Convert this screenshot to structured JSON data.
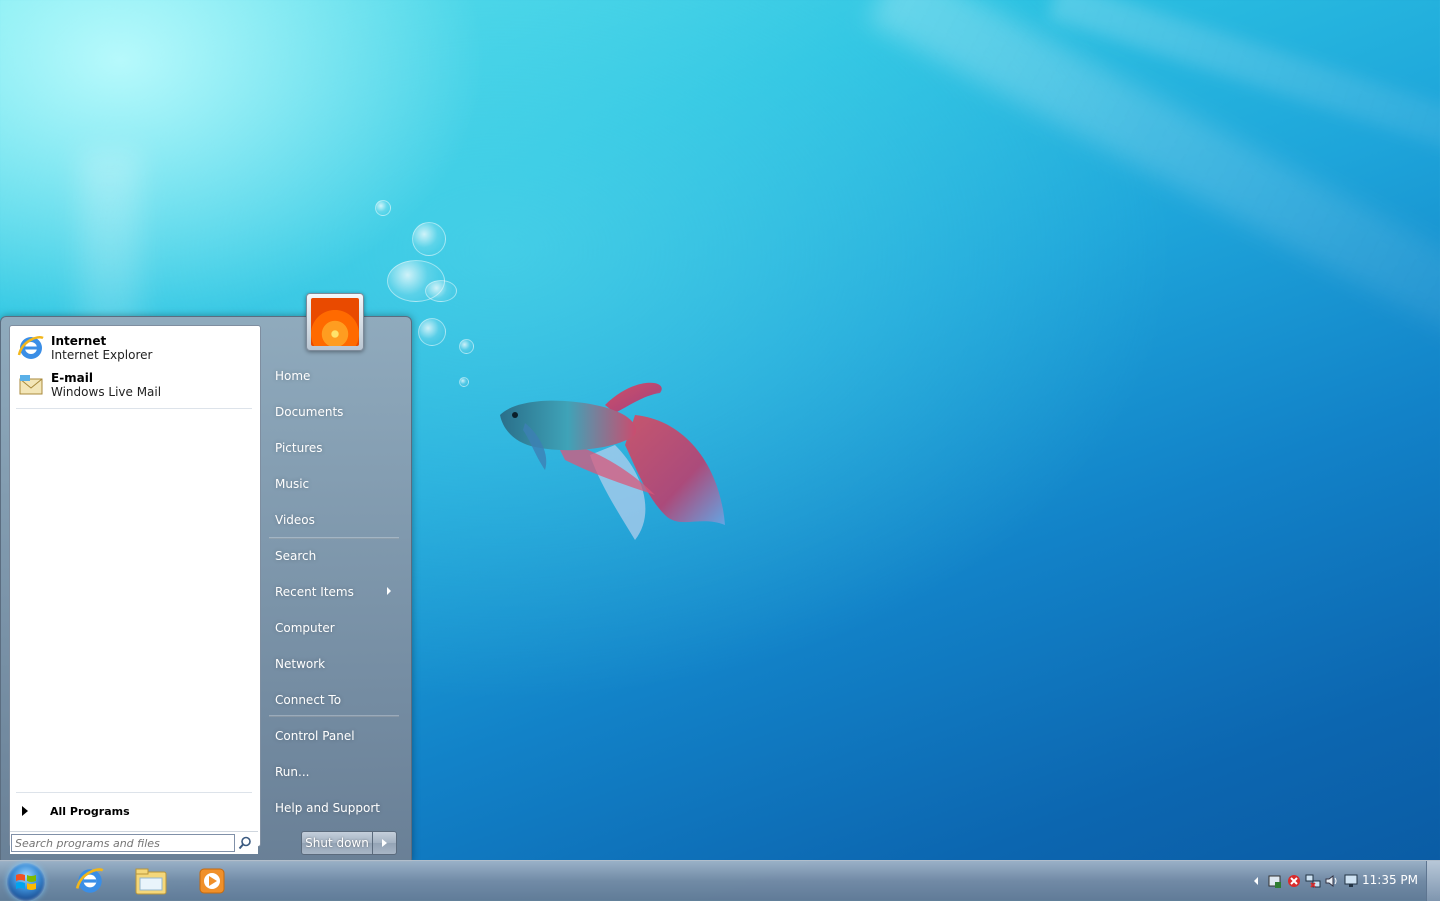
{
  "pinned": [
    {
      "title": "Internet",
      "subtitle": "Internet Explorer",
      "icon": "internet-explorer-icon"
    },
    {
      "title": "E-mail",
      "subtitle": "Windows Live Mail",
      "icon": "windows-live-mail-icon"
    }
  ],
  "all_programs": "All Programs",
  "search": {
    "placeholder": "Search programs and files"
  },
  "right_items": [
    "Home",
    "Documents",
    "Pictures",
    "Music",
    "Videos",
    "Search",
    "Recent Items",
    "Computer",
    "Network",
    "Connect To",
    "Control Panel",
    "Run...",
    "Help and Support"
  ],
  "shutdown_label": "Shut down",
  "clock": "11:35 PM",
  "taskbar": {
    "pinned_icons": [
      "internet-explorer-icon",
      "windows-explorer-icon",
      "media-player-icon"
    ]
  }
}
